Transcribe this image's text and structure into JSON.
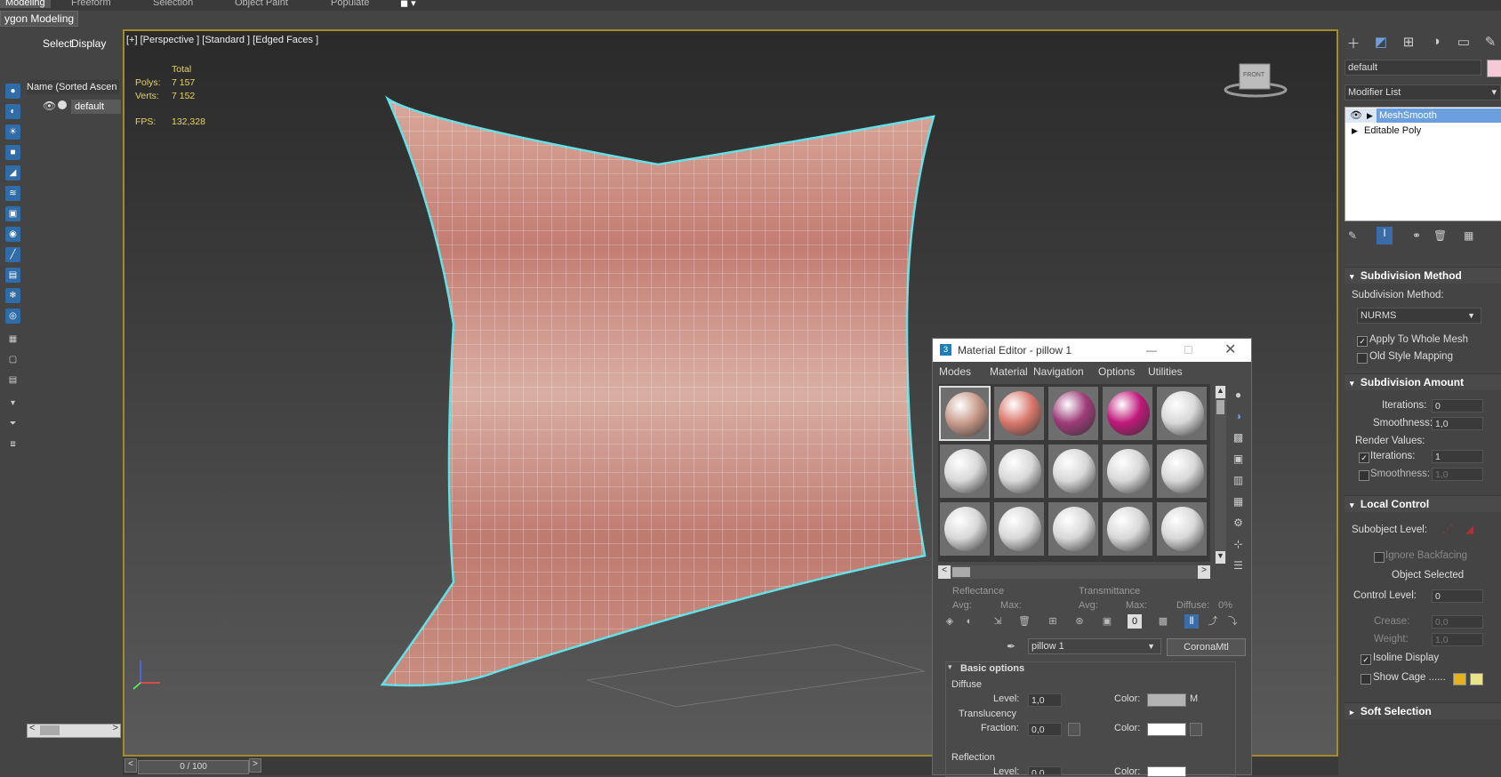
{
  "ribbon": {
    "tabs": [
      "Modeling",
      "Freeform",
      "Selection",
      "Object Paint",
      "Populate"
    ],
    "active_tab": "Modeling",
    "subtab": "ygon Modeling"
  },
  "explorer": {
    "menu_select": "Select",
    "menu_display": "Display",
    "sort_header": "Name (Sorted Ascen",
    "layer_name": "default"
  },
  "viewport": {
    "label": "[+] [Perspective ] [Standard ] [Edged Faces ]",
    "stats": {
      "total_label": "Total",
      "polys_label": "Polys:",
      "polys_value": "7 157",
      "verts_label": "Verts:",
      "verts_value": "7 152",
      "fps_label": "FPS:",
      "fps_value": "132,328"
    },
    "viewcube_label": "FRONT"
  },
  "timeline": {
    "frame": "0 / 100"
  },
  "command_panel": {
    "object_name": "default",
    "object_color": "#f5c9d6",
    "modifier_list": "Modifier List",
    "stack": [
      "MeshSmooth",
      "Editable Poly"
    ],
    "subdivision_method": {
      "title": "Subdivision Method",
      "method_label": "Subdivision Method:",
      "method_value": "NURMS",
      "apply_whole_mesh": "Apply To Whole Mesh",
      "old_style_mapping": "Old Style Mapping"
    },
    "subdivision_amount": {
      "title": "Subdivision Amount",
      "iterations_label": "Iterations:",
      "iterations_value": "0",
      "smoothness_label": "Smoothness:",
      "smoothness_value": "1,0",
      "render_values": "Render Values:",
      "render_iterations_label": "Iterations:",
      "render_iterations_value": "1",
      "render_smoothness_label": "Smoothness:",
      "render_smoothness_value": "1,0"
    },
    "local_control": {
      "title": "Local Control",
      "subobject_label": "Subobject Level:",
      "ignore_backfacing": "Ignore Backfacing",
      "object_selected": "Object Selected",
      "control_level_label": "Control Level:",
      "control_level_value": "0",
      "crease_label": "Crease:",
      "crease_value": "0,0",
      "weight_label": "Weight:",
      "weight_value": "1,0",
      "isoline_display": "Isoline Display",
      "show_cage": "Show Cage ......"
    },
    "soft_selection": {
      "title": "Soft Selection"
    }
  },
  "material_editor": {
    "title": "Material Editor - pillow 1",
    "menus": [
      "Modes",
      "Material",
      "Navigation",
      "Options",
      "Utilities"
    ],
    "reflectance": "Reflectance",
    "transmittance": "Transmittance",
    "avg": "Avg:",
    "max": "Max:",
    "diffuse_pct": "Diffuse:",
    "diffuse_pct_value": "0%",
    "material_name": "pillow 1",
    "material_type": "CoronaMtl",
    "basic_options": "Basic options",
    "diffuse": "Diffuse",
    "level_label": "Level:",
    "level_value": "1,0",
    "color_label": "Color:",
    "map_button": "M",
    "translucency": "Translucency",
    "fraction_label": "Fraction:",
    "fraction_value": "0,0",
    "reflection": "Reflection",
    "refl_level_value": "0,0",
    "slot_colors": [
      "#c89a8a",
      "#d9786c",
      "#9e3c78",
      "#c0187a",
      "#d8d8d8",
      "#d8d8d8",
      "#d8d8d8",
      "#d8d8d8",
      "#d8d8d8",
      "#d8d8d8",
      "#d8d8d8",
      "#d8d8d8",
      "#d8d8d8",
      "#d8d8d8",
      "#d8d8d8"
    ]
  },
  "colors": {
    "viewport_border": "#a58a2a",
    "stat_text": "#e7d45a",
    "selection_outline": "#63e0e6",
    "accent_blue": "#2f6ca8"
  }
}
